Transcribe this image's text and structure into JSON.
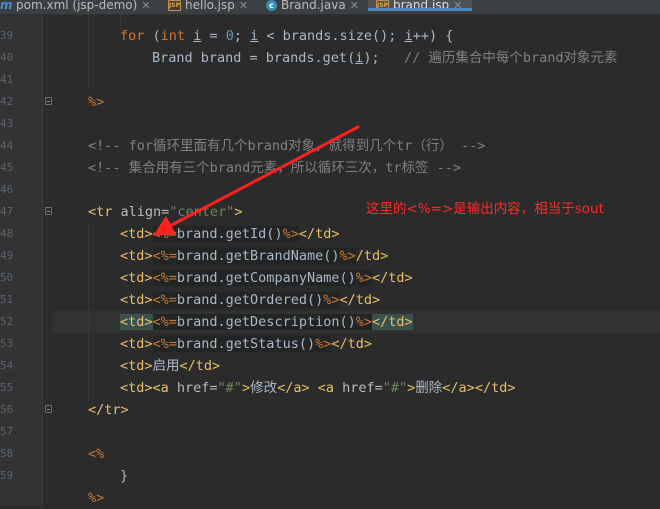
{
  "tabs": [
    {
      "label": "pom.xml (jsp-demo)",
      "icon": "maven-icon",
      "active": false
    },
    {
      "label": "hello.jsp",
      "icon": "jsp-file-icon",
      "active": false
    },
    {
      "label": "Brand.java",
      "icon": "java-class-icon",
      "active": false
    },
    {
      "label": "brand.jsp",
      "icon": "jsp-file-icon",
      "active": true
    }
  ],
  "tab_icon_text": {
    "jsp": "JSP",
    "class": "c",
    "maven": "m"
  },
  "line_numbers": [
    "39",
    "40",
    "41",
    "42",
    "43",
    "44",
    "45",
    "46",
    "47",
    "48",
    "49",
    "50",
    "51",
    "52",
    "53",
    "54",
    "55",
    "56",
    "57",
    "58",
    "59"
  ],
  "code": {
    "l39": {
      "kw_for": "for",
      "open": " (",
      "kw_int": "int",
      "i1": "i",
      "eq": " = ",
      "zero": "0",
      "semi1": "; ",
      "i2": "i",
      "lt": " < brands.size(); ",
      "i3": "i",
      "rest": "++) {"
    },
    "l40": {
      "a": "Brand brand = brands.get(",
      "i": "i",
      "b": ");   ",
      "comment": "// 遍历集合中每个brand对象元素"
    },
    "l42": {
      "close": "%>"
    },
    "l44": {
      "comment": "<!-- for循环里面有几个brand对象，就得到几个tr（行） -->"
    },
    "l45": {
      "comment": "<!-- 集合用有三个brand元素，所以循环三次，tr标签 -->"
    },
    "l47": {
      "open": "<tr ",
      "attr": "align=",
      "value": "\"center\"",
      "close": ">"
    },
    "l48": {
      "td_open": "<td>",
      "jsp_open": "<%=",
      "expr": "brand.getId()",
      "jsp_close": "%>",
      "td_close": "</td>"
    },
    "l49": {
      "td_open": "<td>",
      "jsp_open": "<%=",
      "expr": "brand.getBrandName()",
      "jsp_close": "%>",
      "td_close": "/td>"
    },
    "l50": {
      "td_open": "<td>",
      "jsp_open": "<%=",
      "expr": "brand.getCompanyName()",
      "jsp_close": "%>",
      "td_close": "</td>"
    },
    "l51": {
      "td_open": "<td>",
      "jsp_open": "<%=",
      "expr": "brand.getOrdered()",
      "jsp_close": "%>",
      "td_close": "</td>"
    },
    "l52": {
      "td_open": "<td>",
      "jsp_open": "<%=",
      "expr": "brand.getDescription()",
      "jsp_close": "%>",
      "td_close": "</td>"
    },
    "l53": {
      "td_open": "<td>",
      "jsp_open": "<%=",
      "expr": "brand.getStatus()",
      "jsp_close": "%>",
      "td_close": "</td>"
    },
    "l54": {
      "td_open": "<td>",
      "text": "启用",
      "td_close": "</td>"
    },
    "l55": {
      "td_open": "<td>",
      "a1_open": "<a ",
      "a1_attr": "href=",
      "a1_val": "\"#\"",
      "a1_gt": ">",
      "a1_text": "修改",
      "a1_close": "</a>",
      "sp": " ",
      "a2_open": "<a ",
      "a2_attr": "href=",
      "a2_val": "\"#\"",
      "a2_gt": ">",
      "a2_text": "删除",
      "a2_close": "</a>",
      "td_close": "</td>"
    },
    "l56": {
      "close": "</tr>"
    },
    "l58": {
      "open": "<%"
    },
    "l59": {
      "brace": "}"
    },
    "l60": {
      "close": "%>"
    }
  },
  "annotation": {
    "text": "这里的<%=>是输出内容，相当于sout",
    "color": "#ff2a2a"
  },
  "theme": {
    "background": "#2b2b2b",
    "keyword": "#cc7832",
    "tag": "#e8bf6a",
    "string": "#6a8759",
    "comment": "#808080",
    "number": "#6897bb",
    "text": "#a9b7c6"
  }
}
